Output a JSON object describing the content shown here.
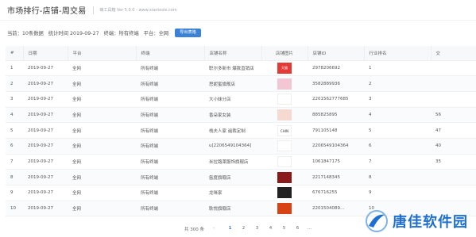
{
  "app": {
    "title": "市场排行-店铺-周交易",
    "meta": "萌工具箱  Ver 5.0.0 - www.xiaotools.com"
  },
  "info": {
    "current": "当前：10条数据",
    "stat_time": "统计时间 2019-09-27",
    "terminal": "终端：所有终端",
    "platform": "平台：全网",
    "export_label": "导出表格"
  },
  "table": {
    "headers": [
      "#",
      "日期",
      "平台",
      "终端",
      "店铺名称",
      "店铺图片",
      "店铺ID",
      "行业排名",
      "交"
    ],
    "rows": [
      {
        "idx": "1",
        "date": "2019-09-27",
        "platform": "全网",
        "terminal": "所有终端",
        "name": "职尔多新市 爆款直销店",
        "img": "天猫",
        "img_color": "#e53935",
        "id": "2978206692",
        "rank": "1",
        "extra": ""
      },
      {
        "idx": "2",
        "date": "2019-09-27",
        "platform": "全网",
        "terminal": "所有终端",
        "name": "思妮蜜旗舰店",
        "img": "",
        "img_color": "#f3c6d3",
        "id": "3582889936",
        "rank": "2",
        "extra": ""
      },
      {
        "idx": "3",
        "date": "2019-09-27",
        "platform": "全网",
        "terminal": "所有终端",
        "name": "大小妹分店",
        "img": "",
        "img_color": "#ffffff",
        "id": "2201562777685",
        "rank": "3",
        "extra": ""
      },
      {
        "idx": "4",
        "date": "2019-09-27",
        "platform": "全网",
        "terminal": "所有终端",
        "name": "香朵家女装",
        "img": "",
        "img_color": "#f6d9d0",
        "id": "885825895",
        "rank": "4",
        "extra": "56"
      },
      {
        "idx": "5",
        "date": "2019-09-27",
        "platform": "全网",
        "terminal": "所有终端",
        "name": "栈夫人家 遍裁定制",
        "img": "CHIN",
        "img_color": "#ffffff",
        "id": "791105148",
        "rank": "5",
        "extra": "47"
      },
      {
        "idx": "6",
        "date": "2019-09-27",
        "platform": "全网",
        "terminal": "所有终端",
        "name": "u[2206549104364]",
        "img": "",
        "img_color": "#ffffff",
        "id": "2206549104364",
        "rank": "6",
        "extra": "40"
      },
      {
        "idx": "7",
        "date": "2019-09-27",
        "platform": "全网",
        "terminal": "所有终端",
        "name": "米拉路莱服饰旗舰店",
        "img": "",
        "img_color": "#ffffff",
        "id": "1061847175",
        "rank": "7",
        "extra": "35"
      },
      {
        "idx": "8",
        "date": "2019-09-27",
        "platform": "全网",
        "terminal": "所有终端",
        "name": "氤度旗舰店",
        "img": "",
        "img_color": "#8b1a1a",
        "id": "2217148345",
        "rank": "8",
        "extra": ""
      },
      {
        "idx": "9",
        "date": "2019-09-27",
        "platform": "全网",
        "terminal": "所有终端",
        "name": "龙咪家",
        "img": "",
        "img_color": "#222222",
        "id": "676716255",
        "rank": "9",
        "extra": ""
      },
      {
        "idx": "10",
        "date": "2019-09-27",
        "platform": "全网",
        "terminal": "所有终端",
        "name": "耿悦旗舰店",
        "img": "",
        "img_color": "#d84315",
        "id": "2201504089...",
        "rank": "10",
        "extra": ""
      }
    ]
  },
  "pager": {
    "total": "共 300 条",
    "prev": "‹",
    "pages": [
      "1",
      "2",
      "3",
      "4",
      "5",
      "6",
      "..."
    ],
    "active": "1"
  },
  "watermark": {
    "text": "唐佳软件园"
  }
}
